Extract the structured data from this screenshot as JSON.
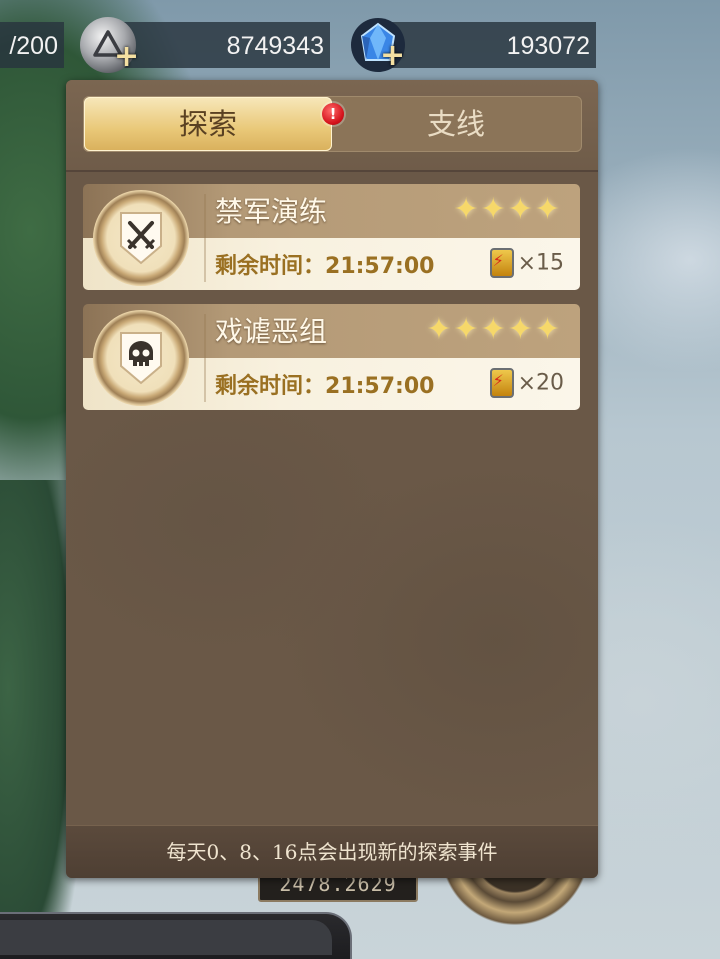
{
  "top_bar": {
    "energy": {
      "value": "/200"
    },
    "silver": {
      "value": "8749343",
      "icon": "silver-coin-icon",
      "plus": "+"
    },
    "gems": {
      "value": "193072",
      "icon": "blue-crystal-icon",
      "plus": "+"
    }
  },
  "panel": {
    "tabs": [
      {
        "label": "探索",
        "active": true,
        "badge": "!"
      },
      {
        "label": "支线",
        "active": false
      }
    ],
    "events": [
      {
        "name": "禁军演练",
        "icon": "crossed-swords-icon",
        "stars": "✦✦✦✦",
        "rating": 4,
        "time_label": "剩余时间：",
        "time_value": "21:57:00",
        "cost_multiplier": "×",
        "cost_amount": "15",
        "cost_icon": "battery-icon"
      },
      {
        "name": "戏谑恶组",
        "icon": "skull-icon",
        "stars": "✦✦✦✦✦",
        "rating": 5,
        "time_label": "剩余时间：",
        "time_value": "21:57:00",
        "cost_multiplier": "×",
        "cost_amount": "20",
        "cost_icon": "battery-icon"
      }
    ],
    "footer": "每天0、8、16点会出现新的探索事件"
  },
  "map": {
    "coordinates": "2478.2629"
  },
  "colors": {
    "tab_active": "#e9c878",
    "star": "#f6d86a",
    "time_text": "#9a7022",
    "badge": "#d4121b"
  }
}
